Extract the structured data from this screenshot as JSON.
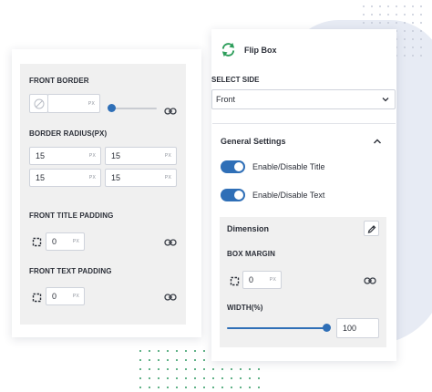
{
  "left_panel": {
    "front_border": {
      "label": "FRONT BORDER",
      "unit": "PX",
      "slider_level": 0.0,
      "icons": [
        "none-border-icon",
        "link-icon"
      ]
    },
    "border_radius": {
      "label": "BORDER RADIUS(PX)",
      "unit": "PX",
      "values": [
        "15",
        "15",
        "15",
        "15"
      ]
    },
    "front_title_padding": {
      "label": "FRONT TITLE PADDING",
      "value": "0",
      "unit": "PX"
    },
    "front_text_padding": {
      "label": "FRONT TEXT PADDING",
      "value": "0",
      "unit": "PX"
    }
  },
  "right_panel": {
    "title": "Flip Box",
    "select_side": {
      "label": "SELECT SIDE",
      "selected": "Front"
    },
    "general_settings": {
      "title": "General Settings",
      "toggles": [
        {
          "label": "Enable/Disable Title",
          "on": true
        },
        {
          "label": "Enable/Disable Text",
          "on": true
        }
      ]
    },
    "dimension": {
      "title": "Dimension",
      "box_margin": {
        "label": "BOX MARGIN",
        "value": "0",
        "unit": "PX"
      },
      "width": {
        "label": "WIDTH(%)",
        "value": "100",
        "level": 1.0
      }
    }
  },
  "colors": {
    "accent": "#2f6fb7",
    "flip_icon": "#2e9e5b",
    "panel_bg": "#f0f0f0"
  }
}
